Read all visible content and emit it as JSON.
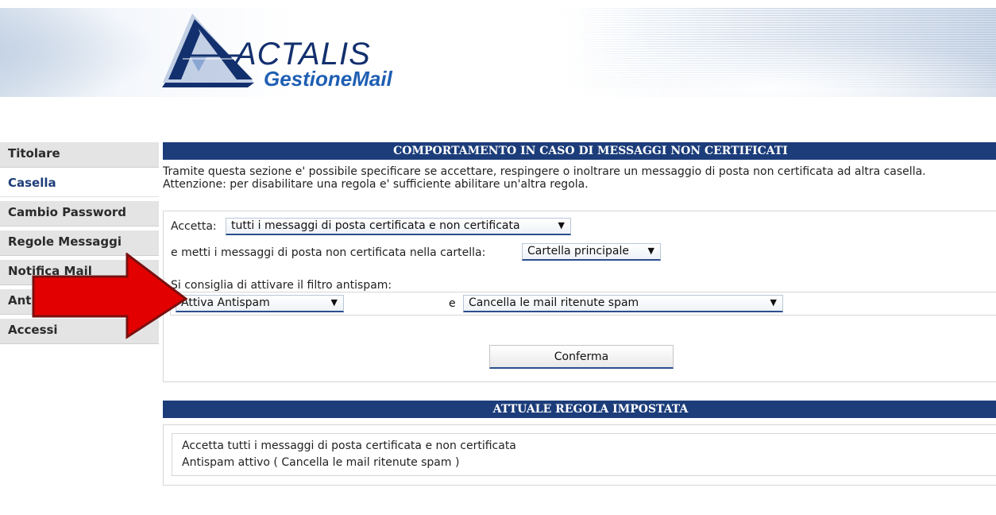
{
  "brand": {
    "company": "ACTALIS",
    "product": "GestioneMail"
  },
  "sidebar": {
    "items": [
      {
        "label": "Titolare"
      },
      {
        "label": "Casella",
        "active": true
      },
      {
        "label": "Cambio Password"
      },
      {
        "label": "Regole Messaggi"
      },
      {
        "label": "Notifica Mail"
      },
      {
        "label": "Antispam"
      },
      {
        "label": "Accessi"
      }
    ]
  },
  "section": {
    "title": "COMPORTAMENTO IN CASO DI MESSAGGI NON CERTIFICATI",
    "description": "Tramite questa sezione e' possibile specificare se accettare, respingere o inoltrare un messaggio di posta non certificata ad altra casella. Attenzione: per disabilitare una regola e' sufficiente abilitare un'altra regola."
  },
  "form": {
    "accept_label": "Accetta:",
    "accept_value": "tutti i messaggi di posta certificata e non certificata",
    "folder_label": "e metti i messaggi di posta non certificata nella cartella:",
    "folder_value": "Cartella principale",
    "antispam_hint": "Si consiglia di attivare il filtro antispam:",
    "antispam_value": "Attiva Antispam",
    "and_label": "e",
    "spam_action_value": "Cancella le mail ritenute spam",
    "confirm_label": "Conferma",
    "dropdown_arrow": "▼"
  },
  "current_rule": {
    "title": "ATTUALE REGOLA IMPOSTATA",
    "line1": "Accetta tutti i messaggi di posta certificata e non certificata",
    "line2": "Antispam attivo  ( Cancella le mail ritenute spam )"
  },
  "colors": {
    "header_bar": "#1c3d7a",
    "annotation_arrow": "#e30000"
  }
}
